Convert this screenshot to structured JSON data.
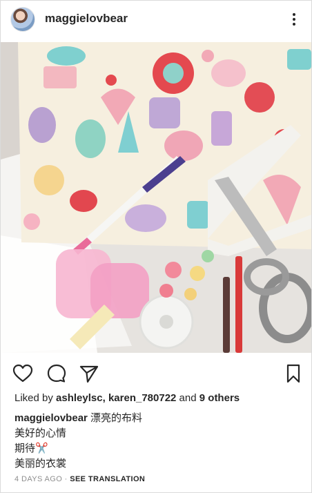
{
  "post": {
    "username": "maggielovbear",
    "photo_alt": "",
    "liked_by_prefix": "Liked by ",
    "liked_user_1": "ashleylsc",
    "liked_sep": ", ",
    "liked_user_2": "karen_780722",
    "liked_and": " and ",
    "liked_others": "9 others",
    "caption_username": "maggielovbear",
    "caption_line_1": " 漂亮的布料",
    "caption_line_2": "美好的心情",
    "caption_line_3": "期待✂️",
    "caption_line_4": "美丽的衣裳",
    "timestamp": "4 DAYS AGO",
    "dot": " · ",
    "see_translation": "SEE TRANSLATION"
  },
  "icons": {
    "like": "heart-outline-icon",
    "comment": "comment-bubble-icon",
    "share": "paper-plane-icon",
    "save": "bookmark-outline-icon",
    "more": "more-options-icon"
  },
  "colors": {
    "text": "#262626",
    "muted": "#8e8e8e",
    "border": "#dbdbdb"
  }
}
